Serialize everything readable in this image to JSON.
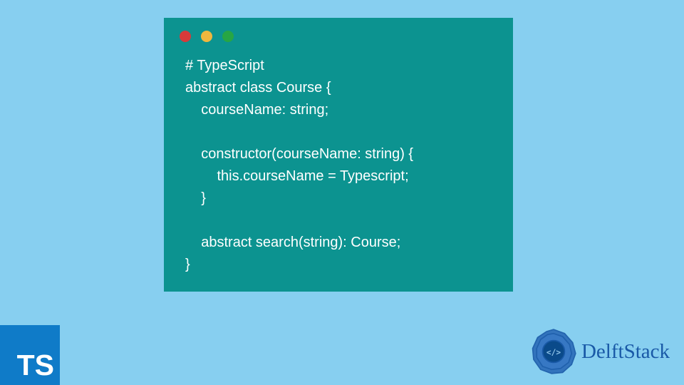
{
  "code": {
    "lines": [
      "# TypeScript",
      "abstract class Course {",
      "    courseName: string;",
      "",
      "    constructor(courseName: string) {",
      "        this.courseName = Typescript;",
      "    }",
      "",
      "    abstract search(string): Course;",
      "}"
    ]
  },
  "ts_badge": "TS",
  "brand": "DelftStack",
  "colors": {
    "background": "#87cff0",
    "window": "#0c9390",
    "ts_badge": "#0f7bc8",
    "brand_text": "#1959a7"
  }
}
